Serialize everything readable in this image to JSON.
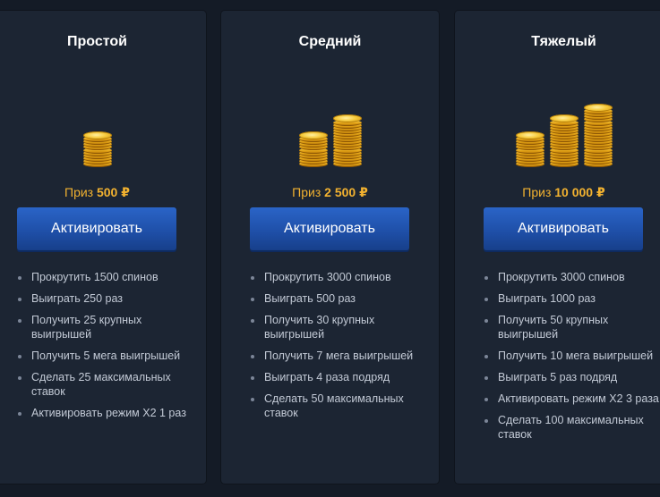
{
  "cards": [
    {
      "title": "Простой",
      "prize_label": "Приз",
      "prize_value": "500 ₽",
      "button_label": "Активировать",
      "coin_stacks": [
        10
      ],
      "tasks": [
        "Прокрутить 1500 спинов",
        "Выиграть 250 раз",
        "Получить 25 крупных выигрышей",
        "Получить 5 мега выигрышей",
        "Сделать 25 максимальных ставок",
        "Активировать режим Х2 1 раз"
      ]
    },
    {
      "title": "Средний",
      "prize_label": "Приз",
      "prize_value": "2 500 ₽",
      "button_label": "Активировать",
      "coin_stacks": [
        10,
        16
      ],
      "tasks": [
        "Прокрутить 3000 спинов",
        "Выиграть 500 раз",
        "Получить 30 крупных выигрышей",
        "Получить 7 мега выигрышей",
        "Выиграть 4 раза подряд",
        "Сделать 50 максимальных ставок"
      ]
    },
    {
      "title": "Тяжелый",
      "prize_label": "Приз",
      "prize_value": "10 000 ₽",
      "button_label": "Активировать",
      "coin_stacks": [
        10,
        16,
        20
      ],
      "tasks": [
        "Прокрутить 3000 спинов",
        "Выиграть 1000 раз",
        "Получить 50 крупных выигрышей",
        "Получить 10 мега выигрышей",
        "Выиграть 5 раз подряд",
        "Активировать режим Х2 3 раза",
        "Сделать 100 максимальных ставок"
      ]
    }
  ],
  "colors": {
    "accent": "#f2b230",
    "button": "#1e4ea6",
    "card": "#1c2533",
    "background": "#141b26"
  },
  "icons": {
    "coins": "gold-coin-stack-icon",
    "bullet": "bullet-dot"
  }
}
